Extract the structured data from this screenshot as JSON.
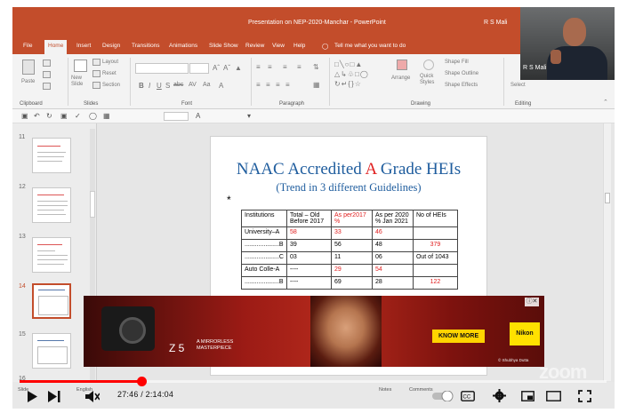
{
  "titlebar": {
    "title": "Presentation on NEP-2020-Manchar - PowerPoint",
    "user": "R S Mali"
  },
  "menu": [
    "File",
    "Home",
    "Insert",
    "Design",
    "Transitions",
    "Animations",
    "Slide Show",
    "Review",
    "View",
    "Help",
    "Tell me what you want to do"
  ],
  "ribbon": {
    "groups": [
      "Clipboard",
      "Slides",
      "Font",
      "Paragraph",
      "Drawing",
      "Editing"
    ],
    "paste": "Paste",
    "new_slide": "New Slide",
    "layout": "Layout",
    "reset": "Reset",
    "section": "Section",
    "arrange": "Arrange",
    "quick_styles": "Quick Styles",
    "shape_fill": "Shape Fill",
    "shape_outline": "Shape Outline",
    "shape_effects": "Shape Effects",
    "select": "Select"
  },
  "thumbnails": [
    {
      "num": "11"
    },
    {
      "num": "12"
    },
    {
      "num": "13"
    },
    {
      "num": "14",
      "selected": true
    },
    {
      "num": "15"
    },
    {
      "num": "16"
    }
  ],
  "slide": {
    "title_before": "NAAC Accredited ",
    "title_red": "A",
    "title_after": " Grade HEIs",
    "subtitle": "(Trend in 3 different Guidelines)",
    "bullet": "*",
    "table": {
      "headers": [
        "Institutions",
        "Total – Old Before 2017",
        "As per2017 %",
        "As per 2020 % Jan 2021",
        "No of HEIs"
      ],
      "rows": [
        [
          "University–A",
          "58",
          "33",
          "46",
          ""
        ],
        [
          "....................B",
          "39",
          "56",
          "48",
          "379"
        ],
        [
          "....................C",
          "03",
          "11",
          "06",
          "Out of 1043"
        ],
        [
          "Auto Colle-A",
          "----",
          "29",
          "54",
          ""
        ],
        [
          "....................B",
          "----",
          "69",
          "28",
          "122"
        ]
      ]
    }
  },
  "ad": {
    "brand_line1": "A MIRRORLESS",
    "brand_line2": "MASTERPIECE",
    "z5": "Z 5",
    "cta": "KNOW MORE",
    "logo": "Nikon",
    "credit": "© Shubhya Dutta",
    "close": "ⓘ✕"
  },
  "camera": {
    "name": "R S Mali"
  },
  "status": {
    "slide_label": "Slide",
    "language": "English",
    "notes": "Notes",
    "comments": "Comments"
  },
  "player": {
    "time": "27:46 / 2:14:04",
    "progress_fraction": 0.207,
    "watermark": "zoom"
  },
  "colors": {
    "accent": "#c34d2b",
    "slide_title": "#1f5d9e",
    "highlight": "#e02020",
    "progress": "#ff0000"
  }
}
